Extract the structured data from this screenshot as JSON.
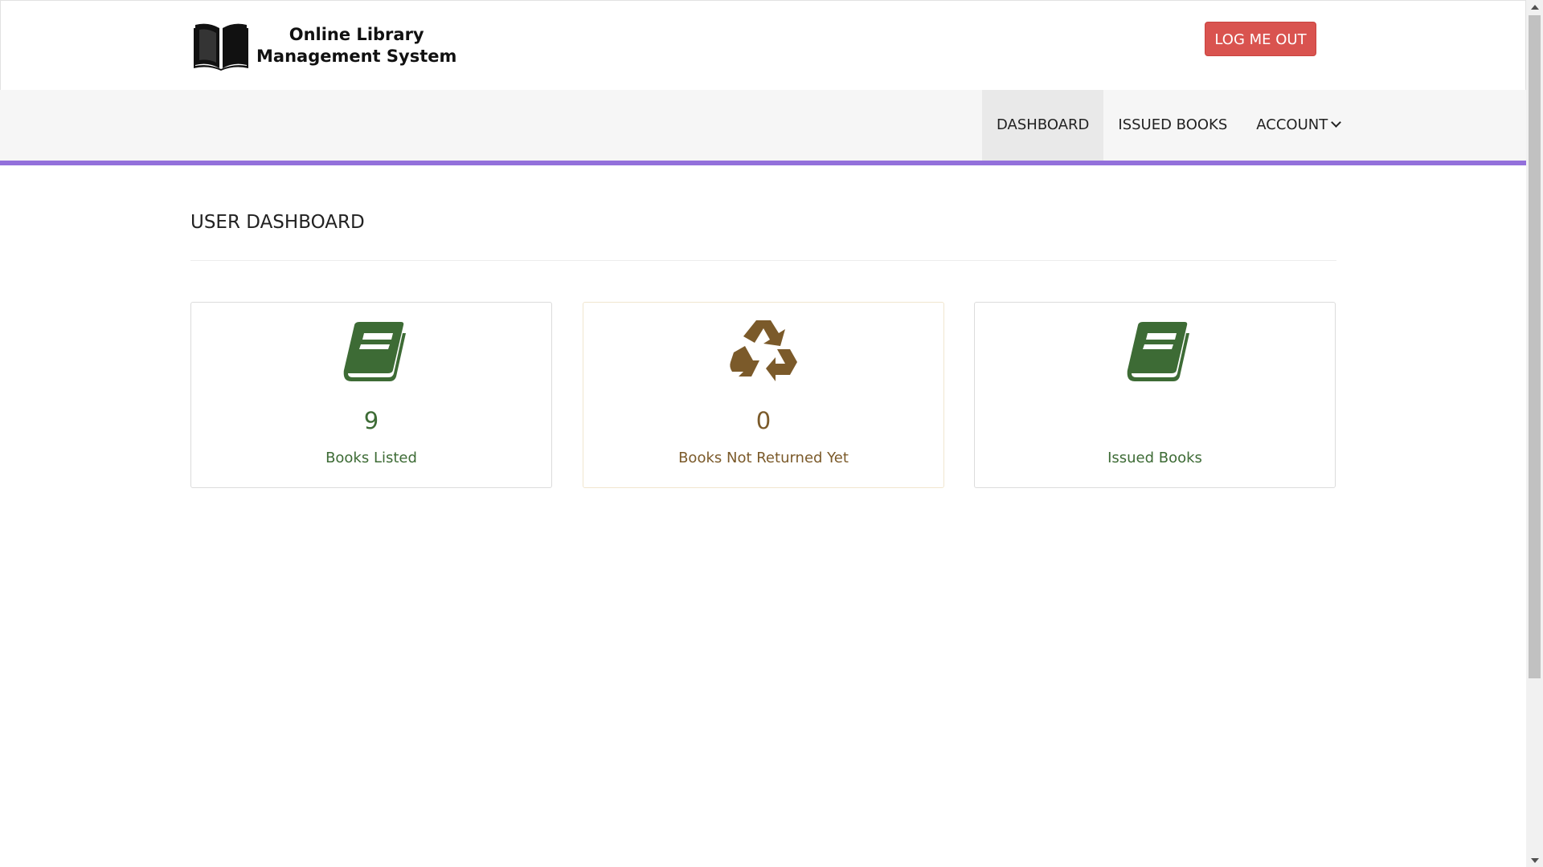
{
  "header": {
    "brand_line1": "Online Library",
    "brand_line2": "Management System",
    "brand_icon": "open-book-icon",
    "logout_label": "LOG ME OUT"
  },
  "nav": {
    "items": [
      {
        "label": "DASHBOARD",
        "active": true
      },
      {
        "label": "ISSUED BOOKS",
        "active": false
      },
      {
        "label": "ACCOUNT",
        "active": false,
        "icon": "chevron-down-icon"
      }
    ]
  },
  "main": {
    "title": "USER DASHBOARD",
    "cards": [
      {
        "icon": "book-icon",
        "count": "9",
        "label": "Books Listed",
        "color": "#3d6b35"
      },
      {
        "icon": "recycle-icon",
        "count": "0",
        "label": "Books Not Returned Yet",
        "color": "#7b5a2a"
      },
      {
        "icon": "book-icon",
        "count": "",
        "label": "Issued Books",
        "color": "#3d6b35"
      }
    ]
  },
  "colors": {
    "accent": "#9370db",
    "logout": "#d9534f",
    "green": "#3d6b35",
    "brown": "#7b5a2a"
  }
}
